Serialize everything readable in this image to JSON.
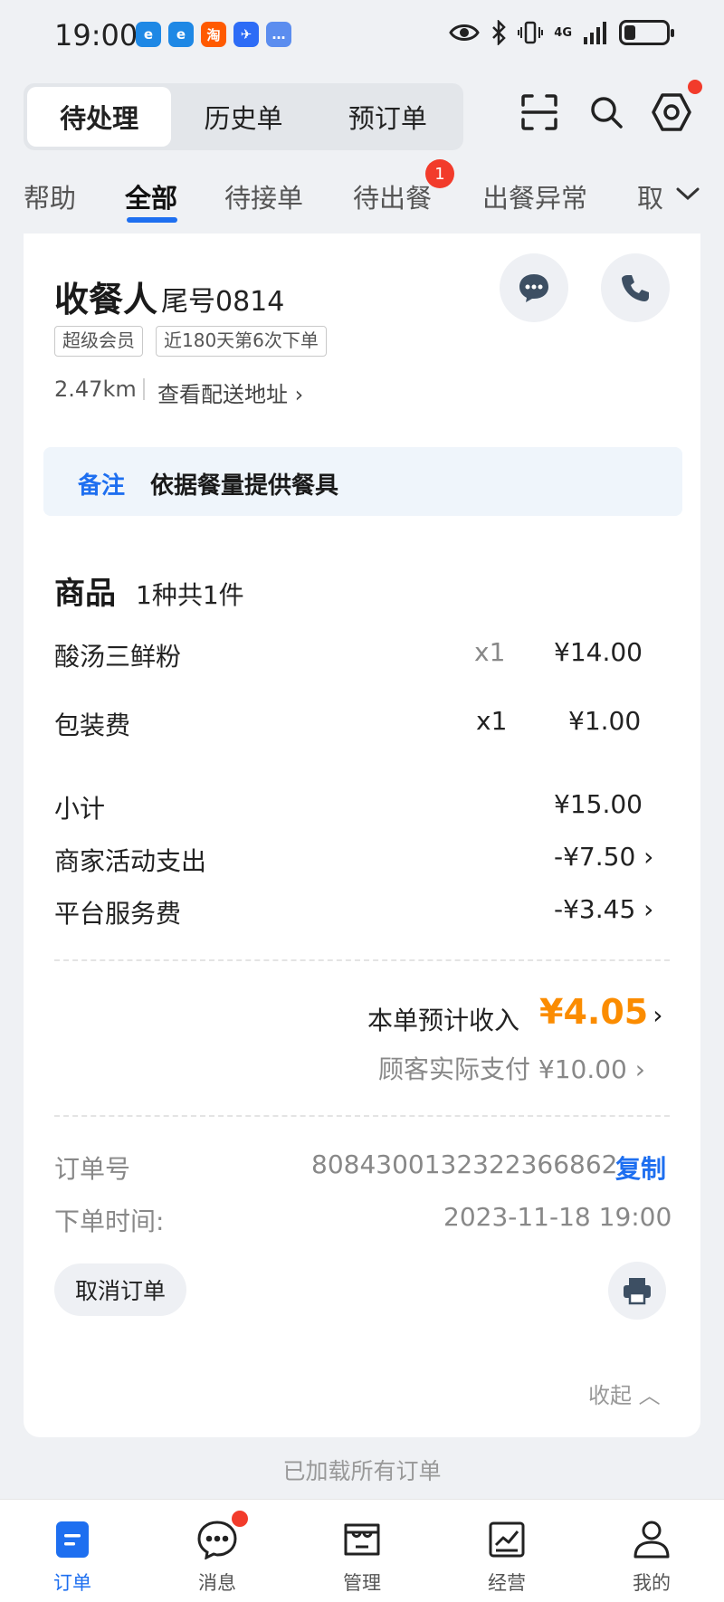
{
  "status_bar": {
    "time": "19:00",
    "notification_apps": [
      {
        "name": "browser-app-icon",
        "glyph": "e",
        "color": "#1e88e5"
      },
      {
        "name": "browser-app-icon-2",
        "glyph": "e",
        "color": "#1e88e5"
      },
      {
        "name": "taobao-app-icon",
        "glyph": "淘",
        "color": "#ff5a00"
      },
      {
        "name": "feishu-app-icon",
        "glyph": "✈",
        "color": "#2d6cf6"
      },
      {
        "name": "message-app-icon",
        "glyph": "…",
        "color": "#5b8def"
      }
    ],
    "network": "4G"
  },
  "header": {
    "tabs": [
      {
        "label": "待处理",
        "active": true
      },
      {
        "label": "历史单",
        "active": false
      },
      {
        "label": "预订单",
        "active": false
      }
    ],
    "icons": [
      "scan-icon",
      "search-icon",
      "settings-icon"
    ]
  },
  "category_tabs": {
    "items": [
      {
        "label": "帮助"
      },
      {
        "label": "全部",
        "active": true
      },
      {
        "label": "待接单"
      },
      {
        "label": "待出餐",
        "badge": "1"
      },
      {
        "label": "出餐异常"
      },
      {
        "label": "取"
      }
    ]
  },
  "order": {
    "recipient_label": "收餐人",
    "phone_tail": "尾号0814",
    "tags": [
      "超级会员",
      "近180天第6次下单"
    ],
    "distance": "2.47km",
    "address_link": "查看配送地址",
    "note_label": "备注",
    "note_text": "依据餐量提供餐具",
    "goods_title": "商品",
    "goods_count": "1种共1件",
    "items": [
      {
        "name": "酸汤三鲜粉",
        "qty": "x1",
        "price": "¥14.00"
      },
      {
        "name": "包装费",
        "qty": "x1",
        "price": "¥1.00"
      }
    ],
    "subtotal_label": "小计",
    "subtotal_value": "¥15.00",
    "merchant_activity_label": "商家活动支出",
    "merchant_activity_value": "-¥7.50",
    "platform_fee_label": "平台服务费",
    "platform_fee_value": "-¥3.45",
    "income_label": "本单预计收入",
    "income_value": "¥4.05",
    "customer_paid": "顾客实际支付 ¥10.00",
    "order_no_label": "订单号",
    "order_no": "8084300132322366862",
    "copy_label": "复制",
    "order_time_label": "下单时间:",
    "order_time": "2023-11-18 19:00",
    "cancel_label": "取消订单",
    "collapse_label": "收起"
  },
  "footer_text": "已加载所有订单",
  "bottom_nav": [
    {
      "label": "订单",
      "icon": "order-icon",
      "active": true
    },
    {
      "label": "消息",
      "icon": "message-icon",
      "dot": true
    },
    {
      "label": "管理",
      "icon": "store-icon"
    },
    {
      "label": "经营",
      "icon": "chart-icon"
    },
    {
      "label": "我的",
      "icon": "profile-icon"
    }
  ],
  "colors": {
    "accent": "#1e6ff0",
    "income": "#fb8c00",
    "badge": "#f23b2b"
  }
}
